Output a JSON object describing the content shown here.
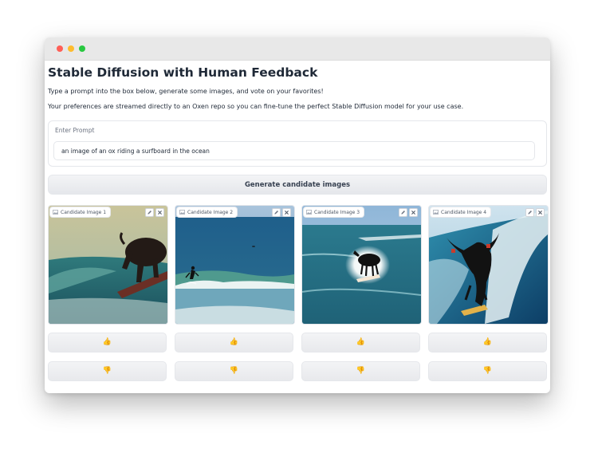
{
  "page": {
    "title": "Stable Diffusion with Human Feedback",
    "description_1": "Type a prompt into the box below, generate some images, and vote on your favorites!",
    "description_2": "Your preferences are streamed directly to an Oxen repo so you can fine-tune the perfect Stable Diffusion model for your use case."
  },
  "prompt": {
    "label": "Enter Prompt",
    "value": "an image of an ox riding a surfboard in the ocean"
  },
  "generate_button": {
    "label": "Generate candidate images"
  },
  "candidates": [
    {
      "label": "Candidate Image 1",
      "upvote": "👍",
      "downvote": "👎"
    },
    {
      "label": "Candidate Image 2",
      "upvote": "👍",
      "downvote": "👎"
    },
    {
      "label": "Candidate Image 3",
      "upvote": "👍",
      "downvote": "👎"
    },
    {
      "label": "Candidate Image 4",
      "upvote": "👍",
      "downvote": "👎"
    }
  ],
  "icons": {
    "window_controls": [
      "close-dot",
      "minimize-dot",
      "maximize-dot"
    ],
    "card_actions": [
      "pencil-icon",
      "close-icon"
    ],
    "card_label": "image-icon"
  },
  "colors": {
    "window_close": "#ff5f57",
    "window_minimize": "#febc2e",
    "window_maximize": "#28c840",
    "button_bg": "#e5e7eb",
    "vote_emoji": "#e8a317"
  }
}
